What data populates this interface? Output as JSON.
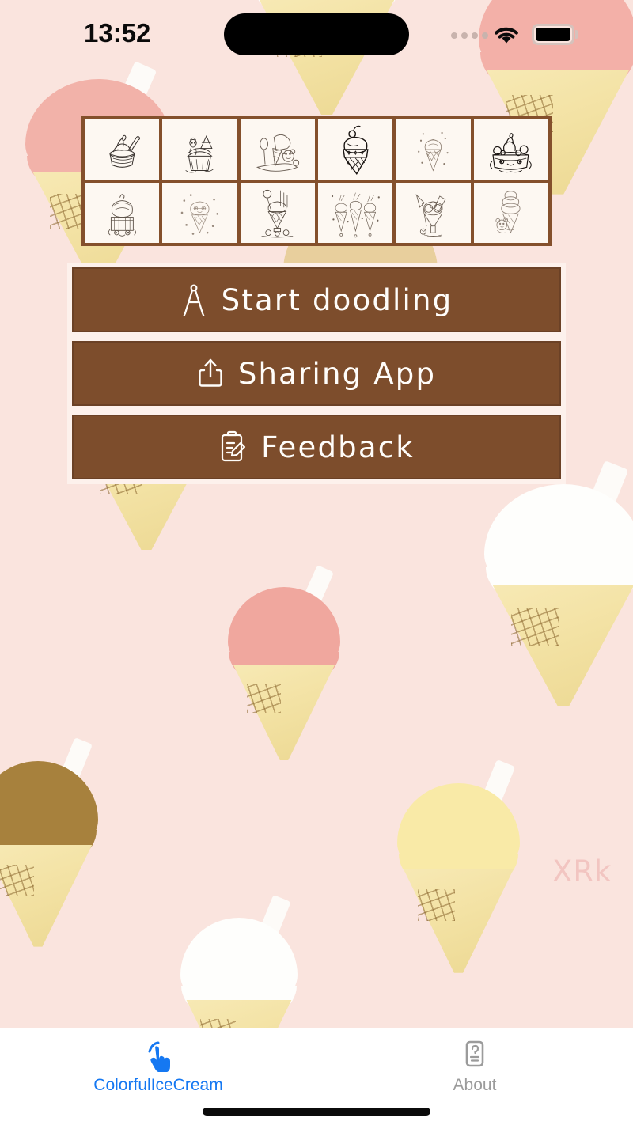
{
  "app": {
    "background_color": "#fae4de",
    "accent_color": "#1578f2",
    "button_color": "#7d4d2c",
    "grid_border_color": "#84502c",
    "watermark": "XRk"
  },
  "status_bar": {
    "time": "13:52",
    "signal_icon": "signal-dots-icon",
    "wifi_icon": "wifi-icon",
    "battery_icon": "battery-icon",
    "dynamic_island": "dynamic-island"
  },
  "gallery": {
    "columns": 6,
    "rows": 2,
    "thumbnails": [
      {
        "id": 1,
        "name": "soft-serve-in-bowl-with-spoon"
      },
      {
        "id": 2,
        "name": "character-on-cupcake-with-tree"
      },
      {
        "id": 3,
        "name": "bear-with-ice-cream-cone-and-spoon"
      },
      {
        "id": 4,
        "name": "cherry-topped-cone-with-stars"
      },
      {
        "id": 5,
        "name": "sparkling-swirl-cone"
      },
      {
        "id": 6,
        "name": "shopkins-sundae-cup-character"
      },
      {
        "id": 7,
        "name": "swirl-cone-character-with-face"
      },
      {
        "id": 8,
        "name": "kawaii-cone-with-glasses-and-confetti"
      },
      {
        "id": 9,
        "name": "tall-parfait-glass-with-lollipop"
      },
      {
        "id": 10,
        "name": "three-cones-with-sprinkles"
      },
      {
        "id": 11,
        "name": "sundae-glass-with-umbrella-and-wafer"
      },
      {
        "id": 12,
        "name": "bear-hugging-tall-cone"
      }
    ]
  },
  "buttons": [
    {
      "key": "start",
      "label": "Start doodling",
      "icon": "compass-divider-icon"
    },
    {
      "key": "share",
      "label": "Sharing App",
      "icon": "share-up-arrow-icon"
    },
    {
      "key": "feedback",
      "label": "Feedback",
      "icon": "clipboard-pencil-icon"
    }
  ],
  "tab_bar": {
    "tabs": [
      {
        "key": "colorful_ice_cream",
        "label": "ColorfulIceCream",
        "icon": "pointing-hand-tap-icon",
        "active": true
      },
      {
        "key": "about",
        "label": "About",
        "icon": "question-document-icon",
        "active": false
      }
    ]
  },
  "wallpaper": {
    "pattern_name": "ice-cream-cone-pattern",
    "cone_flavors": [
      "vanilla-white",
      "strawberry-pink",
      "chocolate-brown",
      "lemon-yellow"
    ]
  }
}
